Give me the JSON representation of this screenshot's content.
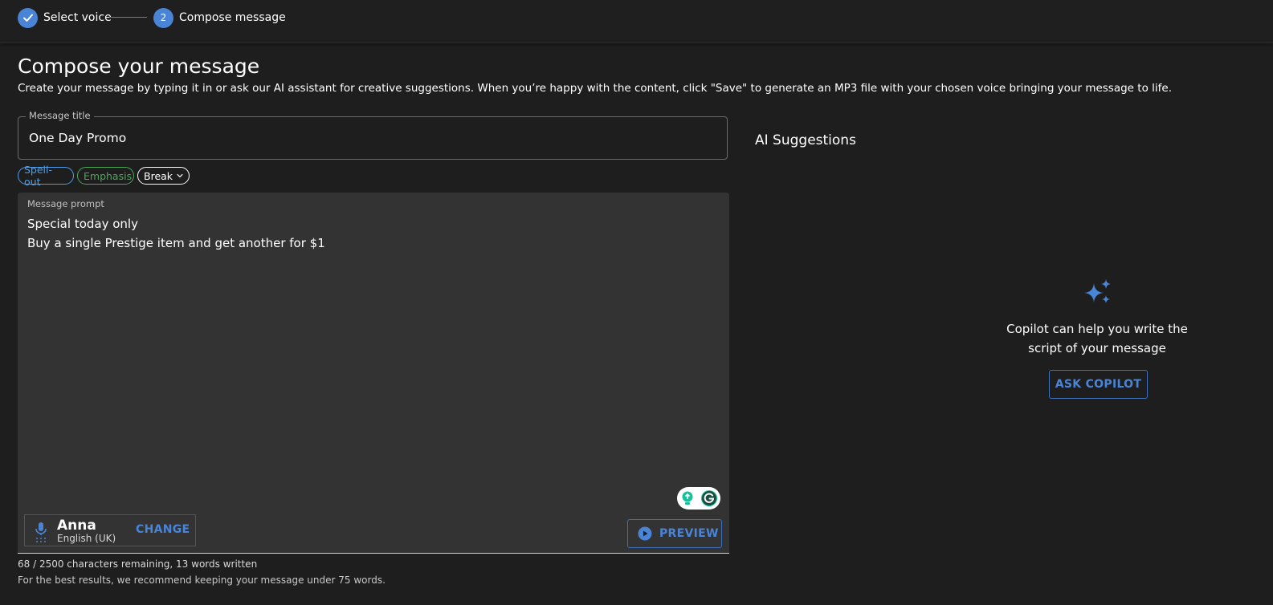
{
  "stepper": {
    "steps": [
      {
        "label": "Select voice",
        "state": "completed",
        "icon": "check-icon"
      },
      {
        "label": "Compose message",
        "number": "2",
        "state": "active"
      }
    ]
  },
  "page": {
    "title": "Compose your message",
    "description": "Create your message by typing it in or ask our AI assistant for creative suggestions. When you’re happy with the content, click \"Save\" to generate an MP3 file with your chosen voice bringing your message to life."
  },
  "message_title": {
    "label": "Message title",
    "value": "One Day Promo"
  },
  "chips": {
    "spell_out": "Spell-out",
    "emphasis": "Emphasis",
    "break": "Break"
  },
  "prompt": {
    "label": "Message prompt",
    "lines": [
      "Special today only",
      "Buy a single Prestige item and get another for $1"
    ]
  },
  "voice": {
    "name": "Anna",
    "language": "English (UK)",
    "change_label": "CHANGE",
    "icon": "microphone-icon"
  },
  "preview": {
    "label": "PREVIEW",
    "icon": "play-circle-icon"
  },
  "footer": {
    "char_count": "68 / 2500 characters remaining, 13 words written",
    "hint": "For the best results, we recommend keeping your message under 75 words."
  },
  "ai": {
    "title": "AI Suggestions",
    "copilot_text": "Copilot can help you write the script of your message",
    "ask_label": "ASK COPILOT",
    "icon": "sparkle-icon"
  },
  "colors": {
    "background": "#1e1e1e",
    "accent": "#4a84d6",
    "prompt_bg": "#333333",
    "spell_out": "#4d9ee8",
    "emphasis": "#4fa65a"
  }
}
